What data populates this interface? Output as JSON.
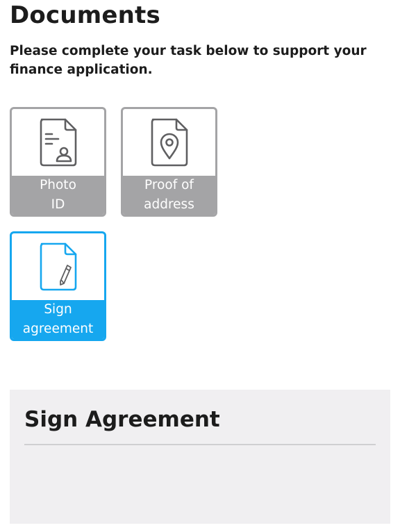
{
  "header": {
    "title": "Documents",
    "subtitle": "Please complete your task below to support your finance application."
  },
  "tiles": [
    {
      "id": "photo-id",
      "line1": "Photo",
      "line2": "ID",
      "icon": "id-document-icon",
      "state": "default"
    },
    {
      "id": "proof-of-address",
      "line1": "Proof of",
      "line2": "address",
      "icon": "location-document-icon",
      "state": "default"
    },
    {
      "id": "sign-agreement",
      "line1": "Sign",
      "line2": "agreement",
      "icon": "sign-document-icon",
      "state": "active"
    }
  ],
  "panel": {
    "title": "Sign Agreement"
  },
  "colors": {
    "inactive": "#a4a4a6",
    "icon_inactive": "#5f5f61",
    "active": "#16a7ef",
    "panel_bg": "#f0eff1",
    "text": "#1c1c1c"
  }
}
